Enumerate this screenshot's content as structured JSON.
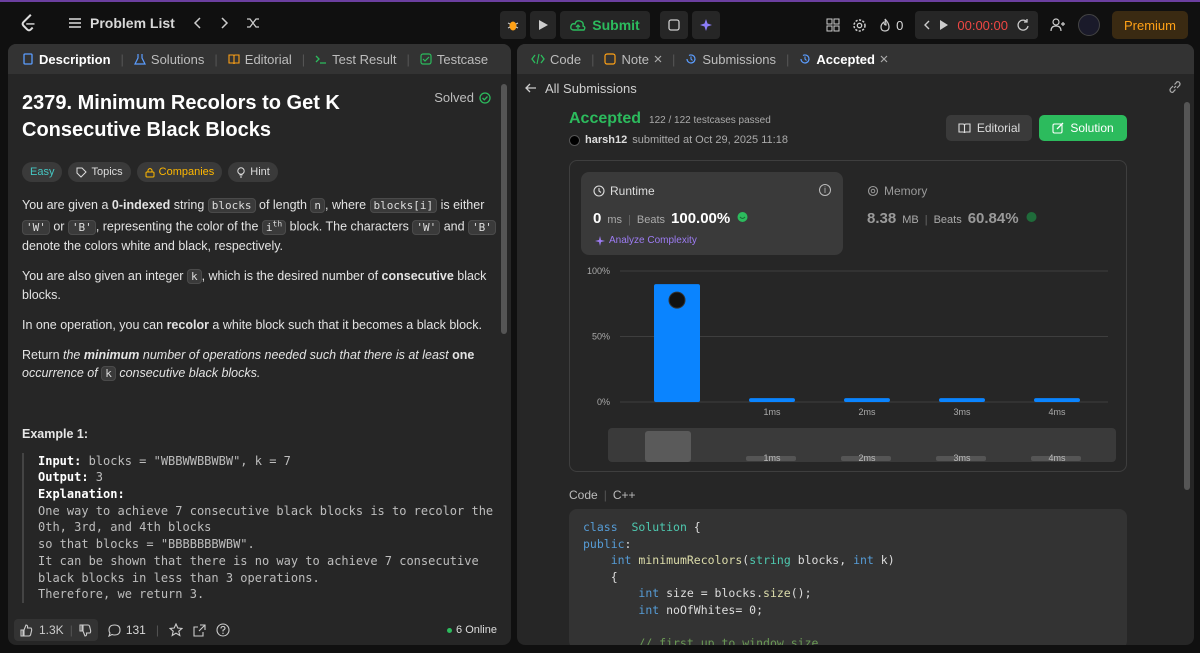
{
  "topbar": {
    "problem_list_label": "Problem List",
    "submit_label": "Submit",
    "streak_count": "0",
    "timer": "00:00:00",
    "premium_label": "Premium"
  },
  "left_tabs": [
    {
      "label": "Description"
    },
    {
      "label": "Solutions"
    },
    {
      "label": "Editorial"
    },
    {
      "label": "Test Result"
    },
    {
      "label": "Testcase"
    }
  ],
  "problem": {
    "title": "2379. Minimum Recolors to Get K Consecutive Black Blocks",
    "status": "Solved",
    "chips": {
      "difficulty": "Easy",
      "topics": "Topics",
      "companies": "Companies",
      "hint": "Hint"
    },
    "p1": {
      "a": "You are given a ",
      "b": "0-indexed",
      "c": " string ",
      "code1": "blocks",
      "d": " of length ",
      "code2": "n",
      "e": ", where ",
      "code3": "blocks[i]",
      "f": " is either ",
      "code4": "'W'",
      "g": " or ",
      "code5": "'B'",
      "h": ", representing the color of the ",
      "code6": "i",
      "sup": "th",
      "i": " block. The characters ",
      "code7": "'W'",
      "j": " and ",
      "code8": "'B'",
      "k": " denote the colors white and black, respectively."
    },
    "p2": {
      "a": "You are also given an integer ",
      "code": "k",
      "b": ", which is the desired number of ",
      "strong": "consecutive",
      "c": " black blocks."
    },
    "p3": {
      "a": "In one operation, you can ",
      "strong": "recolor",
      "b": " a white block such that it becomes a black block."
    },
    "p4": {
      "a": "Return ",
      "em1": "the ",
      "strong1": "minimum",
      "em2": " number of operations needed such that there is at least ",
      "strong2": "one",
      "em3": " occurrence of ",
      "code": "k",
      "em4": " consecutive black blocks."
    },
    "example_heading": "Example 1:",
    "example": {
      "input_label": "Input:",
      "input_value": " blocks = \"WBBWWBBWBW\", k = 7",
      "output_label": "Output:",
      "output_value": " 3",
      "explanation_label": "Explanation:",
      "lines": [
        "One way to achieve 7 consecutive black blocks is to recolor the",
        "0th, 3rd, and 4th blocks",
        "so that blocks = \"BBBBBBBWBW\".",
        "It can be shown that there is no way to achieve 7 consecutive",
        "black blocks in less than 3 operations.",
        "Therefore, we return 3."
      ]
    }
  },
  "footer": {
    "likes": "1.3K",
    "comments": "131",
    "online": "6 Online"
  },
  "right_tabs": [
    {
      "label": "Code"
    },
    {
      "label": "Note"
    },
    {
      "label": "Submissions"
    },
    {
      "label": "Accepted"
    }
  ],
  "all_submissions_label": "All Submissions",
  "result": {
    "status": "Accepted",
    "testcases": "122 / 122 testcases passed",
    "user": "harsh12",
    "submitted": "submitted at Oct 29, 2025 11:18",
    "editorial_btn": "Editorial",
    "solution_btn": "Solution",
    "runtime": {
      "label": "Runtime",
      "value": "0",
      "unit": "ms",
      "beats_label": "Beats",
      "beats": "100.00%",
      "analyze": "Analyze Complexity"
    },
    "memory": {
      "label": "Memory",
      "value": "8.38",
      "unit": "MB",
      "beats_label": "Beats",
      "beats": "60.84%"
    }
  },
  "chart_data": {
    "type": "bar",
    "categories": [
      "0ms",
      "1ms",
      "2ms",
      "3ms",
      "4ms"
    ],
    "category_labels": [
      "",
      "1ms",
      "2ms",
      "3ms",
      "4ms"
    ],
    "values": [
      90,
      3,
      3,
      3,
      3
    ],
    "ylim": [
      0,
      100
    ],
    "yticks": [
      "100%",
      "50%",
      "0%"
    ],
    "colors": {
      "bar": "#0a84ff",
      "grid": "#3e3e3e"
    },
    "title": "",
    "xlabel": "",
    "ylabel": ""
  },
  "code": {
    "label": "Code",
    "language": "C++",
    "lines": [
      [
        [
          "kw",
          "class"
        ],
        [
          "",
          "  "
        ],
        [
          "ty",
          "Solution"
        ],
        [
          "",
          " {"
        ]
      ],
      [
        [
          "kw",
          "public"
        ],
        [
          "",
          ":"
        ]
      ],
      [
        [
          "",
          "    "
        ],
        [
          "kw",
          "int"
        ],
        [
          "",
          " "
        ],
        [
          "fn",
          "minimumRecolors"
        ],
        [
          "",
          "("
        ],
        [
          "ty",
          "string"
        ],
        [
          "",
          " blocks, "
        ],
        [
          "kw",
          "int"
        ],
        [
          "",
          " k)"
        ]
      ],
      [
        [
          "",
          "    {"
        ]
      ],
      [
        [
          "",
          "        "
        ],
        [
          "kw",
          "int"
        ],
        [
          "",
          " size = blocks."
        ],
        [
          "fn",
          "size"
        ],
        [
          "",
          "();"
        ]
      ],
      [
        [
          "",
          "        "
        ],
        [
          "kw",
          "int"
        ],
        [
          "",
          " noOfWhites= 0;"
        ]
      ],
      [
        [
          "",
          ""
        ]
      ],
      [
        [
          "",
          "        "
        ],
        [
          "cm",
          "// first up to window size"
        ]
      ]
    ]
  }
}
